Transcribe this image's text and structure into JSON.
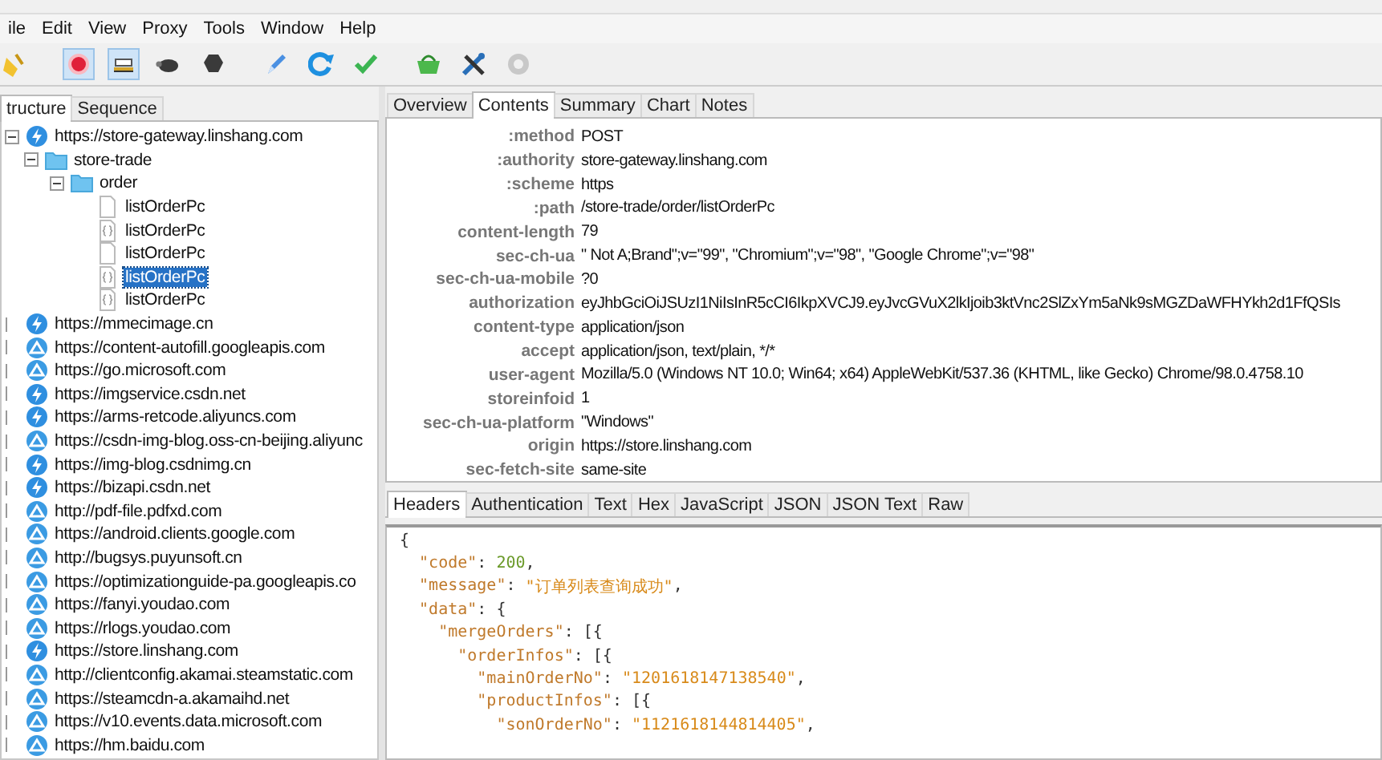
{
  "menu": [
    {
      "label": "ile"
    },
    {
      "label": "Edit"
    },
    {
      "label": "View"
    },
    {
      "label": "Proxy"
    },
    {
      "label": "Tools"
    },
    {
      "label": "Window"
    },
    {
      "label": "Help"
    }
  ],
  "toolbar": [
    [
      {
        "kind": "broom",
        "on": false
      }
    ],
    [
      {
        "kind": "record",
        "on": true
      },
      {
        "kind": "throttle",
        "on": true
      },
      {
        "kind": "turtle",
        "on": false
      },
      {
        "kind": "stop",
        "on": false
      }
    ],
    [
      {
        "kind": "pen",
        "on": false
      },
      {
        "kind": "refresh",
        "on": false
      },
      {
        "kind": "check",
        "on": false
      }
    ],
    [
      {
        "kind": "basket",
        "on": false
      },
      {
        "kind": "tools",
        "on": false
      },
      {
        "kind": "gear",
        "on": false
      }
    ]
  ],
  "left_tabs": [
    {
      "label": "tructure",
      "selected": true
    },
    {
      "label": "Sequence",
      "selected": false
    }
  ],
  "tree": [
    {
      "label": "https://store-gateway.linshang.com",
      "kind": "bolt",
      "expanded": true,
      "selected": false,
      "children": [
        {
          "label": "store-trade",
          "kind": "folder",
          "expanded": true,
          "selected": false,
          "children": [
            {
              "label": "order",
              "kind": "folder",
              "expanded": true,
              "selected": false,
              "children": [
                {
                  "label": "listOrderPc",
                  "kind": "file",
                  "selected": false
                },
                {
                  "label": "listOrderPc",
                  "kind": "json",
                  "selected": false
                },
                {
                  "label": "listOrderPc",
                  "kind": "file",
                  "selected": false
                },
                {
                  "label": "listOrderPc",
                  "kind": "json",
                  "selected": true
                },
                {
                  "label": "listOrderPc",
                  "kind": "json",
                  "selected": false
                }
              ]
            }
          ]
        }
      ]
    },
    {
      "label": "https://mmecimage.cn",
      "kind": "bolt",
      "expanded": false,
      "selected": false
    },
    {
      "label": "https://content-autofill.googleapis.com",
      "kind": "web",
      "expanded": false,
      "selected": false
    },
    {
      "label": "https://go.microsoft.com",
      "kind": "web",
      "expanded": false,
      "selected": false
    },
    {
      "label": "https://imgservice.csdn.net",
      "kind": "bolt",
      "expanded": false,
      "selected": false
    },
    {
      "label": "https://arms-retcode.aliyuncs.com",
      "kind": "bolt",
      "expanded": false,
      "selected": false
    },
    {
      "label": "https://csdn-img-blog.oss-cn-beijing.aliyunc",
      "kind": "web",
      "expanded": false,
      "selected": false
    },
    {
      "label": "https://img-blog.csdnimg.cn",
      "kind": "bolt",
      "expanded": false,
      "selected": false
    },
    {
      "label": "https://bizapi.csdn.net",
      "kind": "bolt",
      "expanded": false,
      "selected": false
    },
    {
      "label": "http://pdf-file.pdfxd.com",
      "kind": "web",
      "expanded": false,
      "selected": false
    },
    {
      "label": "https://android.clients.google.com",
      "kind": "web",
      "expanded": false,
      "selected": false
    },
    {
      "label": "http://bugsys.puyunsoft.cn",
      "kind": "web",
      "expanded": false,
      "selected": false
    },
    {
      "label": "https://optimizationguide-pa.googleapis.co",
      "kind": "web",
      "expanded": false,
      "selected": false
    },
    {
      "label": "https://fanyi.youdao.com",
      "kind": "web",
      "expanded": false,
      "selected": false
    },
    {
      "label": "https://rlogs.youdao.com",
      "kind": "web",
      "expanded": false,
      "selected": false
    },
    {
      "label": "https://store.linshang.com",
      "kind": "bolt",
      "expanded": false,
      "selected": false
    },
    {
      "label": "http://clientconfig.akamai.steamstatic.com",
      "kind": "web",
      "expanded": false,
      "selected": false
    },
    {
      "label": "https://steamcdn-a.akamaihd.net",
      "kind": "web",
      "expanded": false,
      "selected": false
    },
    {
      "label": "https://v10.events.data.microsoft.com",
      "kind": "web",
      "expanded": false,
      "selected": false
    },
    {
      "label": "https://hm.baidu.com",
      "kind": "web",
      "expanded": false,
      "selected": false
    }
  ],
  "right_tabs": [
    {
      "label": "Overview",
      "selected": false
    },
    {
      "label": "Contents",
      "selected": true
    },
    {
      "label": "Summary",
      "selected": false
    },
    {
      "label": "Chart",
      "selected": false
    },
    {
      "label": "Notes",
      "selected": false
    }
  ],
  "headers": [
    {
      "name": ":method",
      "value": "POST"
    },
    {
      "name": ":authority",
      "value": "store-gateway.linshang.com"
    },
    {
      "name": ":scheme",
      "value": "https"
    },
    {
      "name": ":path",
      "value": "/store-trade/order/listOrderPc"
    },
    {
      "name": "content-length",
      "value": "79"
    },
    {
      "name": "sec-ch-ua",
      "value": "\" Not A;Brand\";v=\"99\", \"Chromium\";v=\"98\", \"Google Chrome\";v=\"98\""
    },
    {
      "name": "sec-ch-ua-mobile",
      "value": "?0"
    },
    {
      "name": "authorization",
      "value": "eyJhbGciOiJSUzI1NiIsInR5cCI6IkpXVCJ9.eyJvcGVuX2lkIjoib3ktVnc2SlZxYm5aNk9sMGZDaWFHYkh2d1FfQSIs"
    },
    {
      "name": "content-type",
      "value": "application/json"
    },
    {
      "name": "accept",
      "value": "application/json, text/plain, */*"
    },
    {
      "name": "user-agent",
      "value": "Mozilla/5.0 (Windows NT 10.0; Win64; x64) AppleWebKit/537.36 (KHTML, like Gecko) Chrome/98.0.4758.10"
    },
    {
      "name": "storeinfoid",
      "value": "1"
    },
    {
      "name": "sec-ch-ua-platform",
      "value": "\"Windows\""
    },
    {
      "name": "origin",
      "value": "https://store.linshang.com"
    },
    {
      "name": "sec-fetch-site",
      "value": "same-site"
    }
  ],
  "body_tabs": [
    {
      "label": "Headers",
      "selected": true
    },
    {
      "label": "Authentication",
      "selected": false
    },
    {
      "label": "Text",
      "selected": false
    },
    {
      "label": "Hex",
      "selected": false
    },
    {
      "label": "JavaScript",
      "selected": false
    },
    {
      "label": "JSON",
      "selected": false
    },
    {
      "label": "JSON Text",
      "selected": false
    },
    {
      "label": "Raw",
      "selected": false
    }
  ],
  "body_lines": [
    [
      {
        "kind": "punct",
        "text": "{"
      }
    ],
    [
      {
        "kind": "key",
        "text": "  \"code\""
      },
      {
        "kind": "punct",
        "text": ": "
      },
      {
        "kind": "number",
        "text": "200"
      },
      {
        "kind": "punct",
        "text": ","
      }
    ],
    [
      {
        "kind": "key",
        "text": "  \"message\""
      },
      {
        "kind": "punct",
        "text": ": "
      },
      {
        "kind": "string",
        "text": "\"订单列表查询成功\""
      },
      {
        "kind": "punct",
        "text": ","
      }
    ],
    [
      {
        "kind": "key",
        "text": "  \"data\""
      },
      {
        "kind": "punct",
        "text": ": {"
      }
    ],
    [
      {
        "kind": "key",
        "text": "    \"mergeOrders\""
      },
      {
        "kind": "punct",
        "text": ": [{"
      }
    ],
    [
      {
        "kind": "key",
        "text": "      \"orderInfos\""
      },
      {
        "kind": "punct",
        "text": ": [{"
      }
    ],
    [
      {
        "kind": "key",
        "text": "        \"mainOrderNo\""
      },
      {
        "kind": "punct",
        "text": ": "
      },
      {
        "kind": "string",
        "text": "\"1201618147138540\""
      },
      {
        "kind": "punct",
        "text": ","
      }
    ],
    [
      {
        "kind": "key",
        "text": "        \"productInfos\""
      },
      {
        "kind": "punct",
        "text": ": [{"
      }
    ],
    [
      {
        "kind": "key",
        "text": "          \"sonOrderNo\""
      },
      {
        "kind": "punct",
        "text": ": "
      },
      {
        "kind": "string",
        "text": "\"1121618144814405\""
      },
      {
        "kind": "punct",
        "text": ","
      }
    ]
  ]
}
